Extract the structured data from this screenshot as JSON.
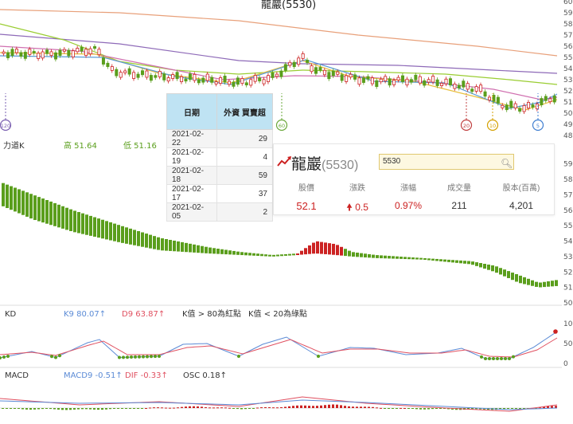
{
  "chart_data": {
    "type": "candlestick",
    "title": "龍巖(5530)",
    "price_axis": {
      "ticks": [
        48,
        49,
        50,
        51,
        52,
        53,
        54,
        55,
        56,
        57,
        58,
        59,
        60
      ],
      "ylim": [
        48,
        60
      ]
    },
    "k_panel": {
      "label": "力道K",
      "high_label": "高 51.64",
      "low_label": "低 51.16",
      "ticks": [
        50,
        51,
        52,
        53,
        54,
        55,
        56,
        57,
        58,
        59
      ],
      "ylim": [
        50,
        59.5
      ]
    },
    "kd": {
      "label": "KD",
      "k_label": "K9 80.07↑",
      "d_label": "D9 63.87↑",
      "note1": "K值 > 80為紅點",
      "note2": "K值 < 20為綠點",
      "ticks": [
        0,
        50,
        100
      ]
    },
    "macd": {
      "label": "MACD",
      "macd_label": "MACD9 -0.51↑",
      "dif_label": "DIF -0.33↑",
      "osc_label": "OSC 0.18↑"
    },
    "ma_markers": [
      "120",
      "60",
      "20",
      "10",
      "5"
    ]
  },
  "institutional": {
    "header_date": "日期",
    "header_value": "外資 買賣超",
    "rows": [
      {
        "date": "2021-02-22",
        "value": "29"
      },
      {
        "date": "2021-02-19",
        "value": "4"
      },
      {
        "date": "2021-02-18",
        "value": "59"
      },
      {
        "date": "2021-02-17",
        "value": "37"
      },
      {
        "date": "2021-02-05",
        "value": "2"
      }
    ]
  },
  "card": {
    "name": "龍巖",
    "code": "(5530)",
    "search_value": "5530",
    "price_label": "股價",
    "price": "52.1",
    "change_label": "漲跌",
    "change": "0.5",
    "pct_label": "漲幅",
    "pct": "0.97%",
    "volume_label": "成交量",
    "volume": "211",
    "capital_label": "股本(百萬)",
    "capital": "4,201"
  },
  "colors": {
    "up": "#cc2222",
    "down": "#5a9e1c",
    "k_line": "#e05060",
    "d_line": "#5b8bd6"
  }
}
